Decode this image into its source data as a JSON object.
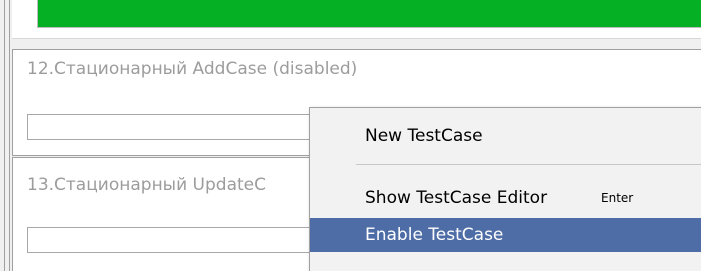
{
  "progress": {
    "fraction": 1.0,
    "color": "#06b025"
  },
  "testcases": [
    {
      "title": "12.Стационарный AddCase (disabled)",
      "input_value": ""
    },
    {
      "title": "13.Стационарный UpdateC",
      "input_value": ""
    }
  ],
  "context_menu": {
    "items": [
      {
        "label": "New TestCase",
        "shortcut": "",
        "highlighted": false
      },
      {
        "label": "Show TestCase Editor",
        "shortcut": "Enter",
        "highlighted": false
      },
      {
        "label": "Enable TestCase",
        "shortcut": "",
        "highlighted": true
      }
    ]
  },
  "colors": {
    "highlight": "#4e6da7",
    "disabled_text": "#9c9c9c"
  }
}
